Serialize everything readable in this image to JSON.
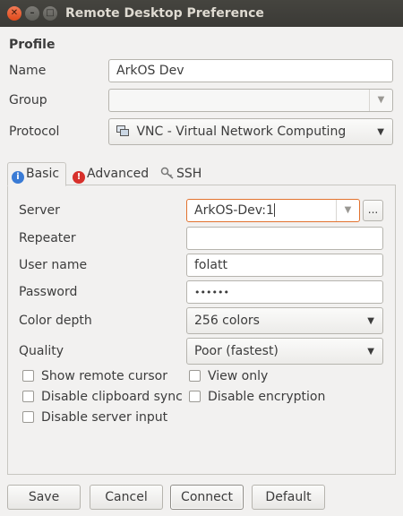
{
  "window": {
    "title": "Remote Desktop Preference"
  },
  "profile": {
    "heading": "Profile",
    "name_label": "Name",
    "name_value": "ArkOS Dev",
    "group_label": "Group",
    "group_value": "",
    "protocol_label": "Protocol",
    "protocol_value": "VNC - Virtual Network Computing"
  },
  "tabs": [
    {
      "label": "Basic",
      "icon": "info-icon",
      "active": true
    },
    {
      "label": "Advanced",
      "icon": "warning-icon",
      "active": false
    },
    {
      "label": "SSH",
      "icon": "key-icon",
      "active": false
    }
  ],
  "basic": {
    "server_label": "Server",
    "server_value": "ArkOS-Dev:1",
    "browse_label": "...",
    "repeater_label": "Repeater",
    "repeater_value": "",
    "username_label": "User name",
    "username_value": "folatt",
    "password_label": "Password",
    "password_value": "••••••",
    "colordepth_label": "Color depth",
    "colordepth_value": "256 colors",
    "quality_label": "Quality",
    "quality_value": "Poor (fastest)"
  },
  "checkboxes": {
    "show_remote_cursor": {
      "label": "Show remote cursor",
      "checked": false
    },
    "view_only": {
      "label": "View only",
      "checked": false
    },
    "disable_clipboard_sync": {
      "label": "Disable clipboard sync",
      "checked": false
    },
    "disable_encryption": {
      "label": "Disable encryption",
      "checked": false
    },
    "disable_server_input": {
      "label": "Disable server input",
      "checked": false
    }
  },
  "buttons": {
    "save": "Save",
    "cancel": "Cancel",
    "connect": "Connect",
    "default": "Default"
  },
  "colors": {
    "focus_border": "#e2732f",
    "close_button": "#e0491a",
    "titlebar": "#3b3a36"
  }
}
